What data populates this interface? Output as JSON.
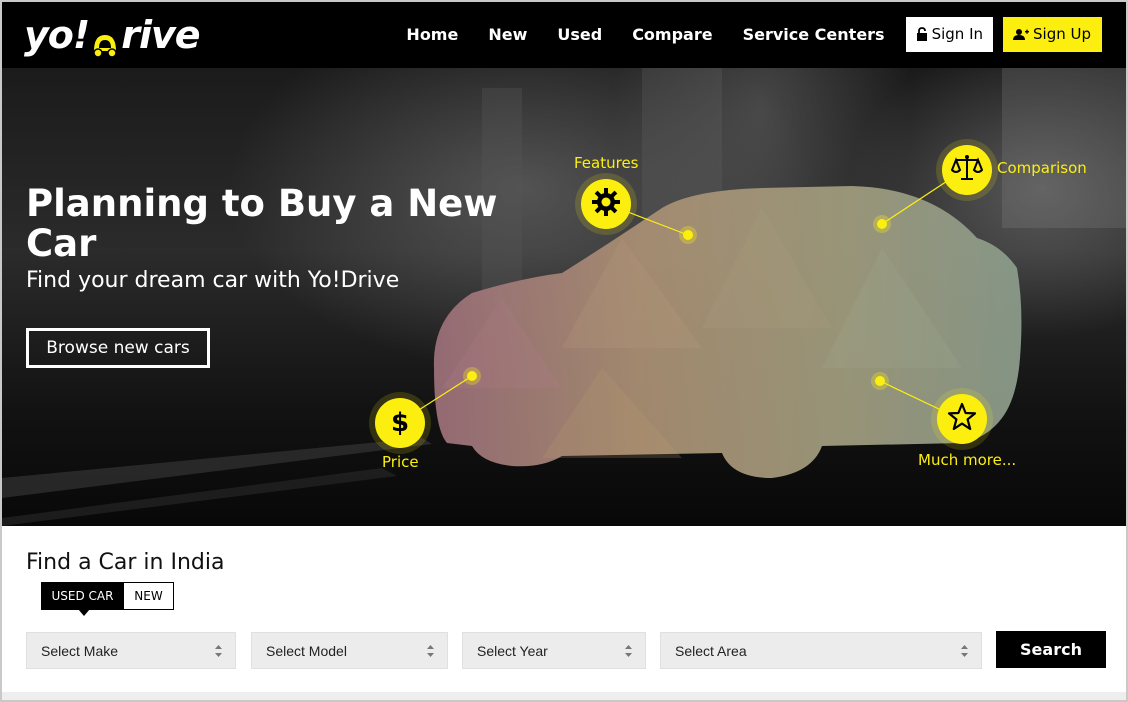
{
  "brand": {
    "logo_text_left": "yo!",
    "logo_text_right": "rive",
    "accent_color": "#fcef0f"
  },
  "nav": {
    "items": [
      "Home",
      "New",
      "Used",
      "Compare",
      "Service Centers"
    ],
    "signin_label": "Sign In",
    "signup_label": "Sign Up"
  },
  "hero": {
    "title": "Planning to Buy a New Car",
    "subtitle": "Find your dream car with Yo!Drive",
    "browse_label": "Browse new cars",
    "features": {
      "features": "Features",
      "comparison": "Comparison",
      "price": "Price",
      "more": "Much more..."
    },
    "icons": {
      "features": "gear-icon",
      "comparison": "scales-icon",
      "price": "dollar-icon",
      "more": "star-icon"
    }
  },
  "search": {
    "title": "Find a Car in India",
    "tabs": [
      "USED CAR",
      "NEW"
    ],
    "active_tab": "USED CAR",
    "selects": [
      "Select Make",
      "Select Model",
      "Select Year",
      "Select Area"
    ],
    "search_label": "Search"
  }
}
